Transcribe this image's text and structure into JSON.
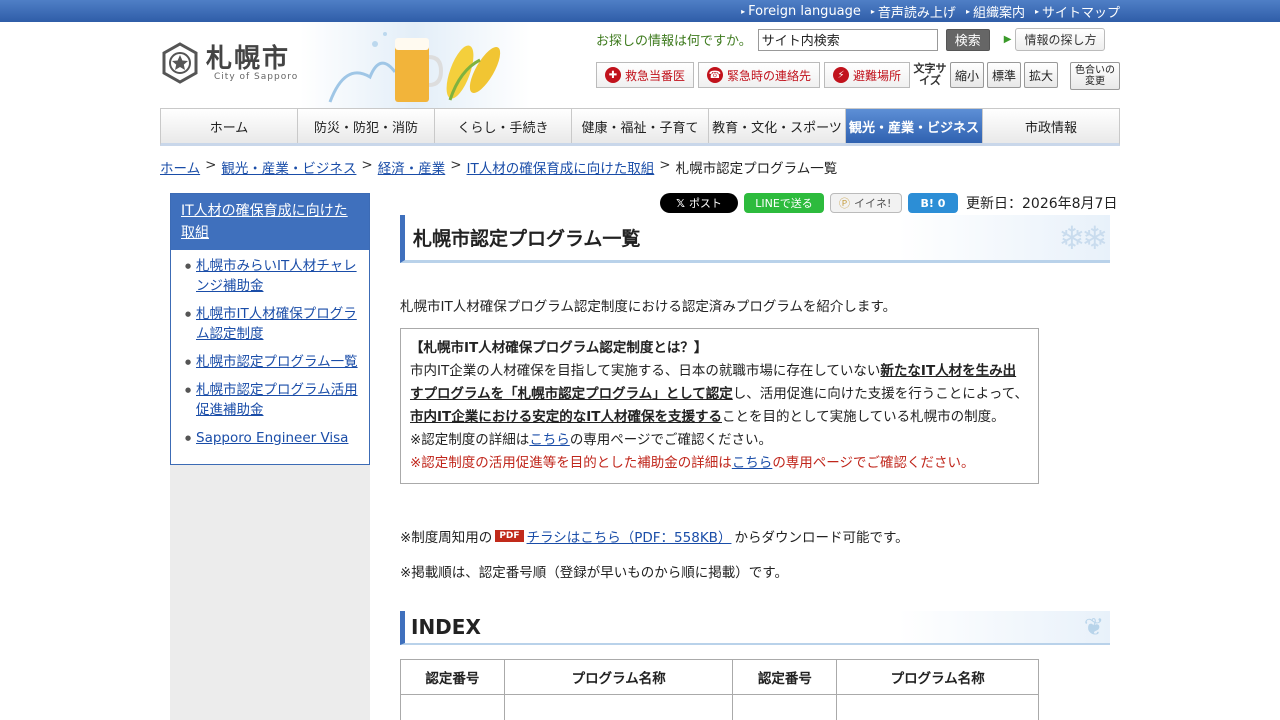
{
  "topbar": {
    "links": [
      "Foreign language",
      "音声読み上げ",
      "組織案内",
      "サイトマップ"
    ]
  },
  "header": {
    "logo_title": "札幌市",
    "logo_sub": "City of Sapporo",
    "search_prompt": "お探しの情報は何ですか。",
    "search_value": "サイト内検索",
    "search_button": "検索",
    "info_guide": "情報の探し方",
    "emergency": [
      "救急当番医",
      "緊急時の連絡先",
      "避難場所"
    ],
    "fontsize_label": "文字サイズ",
    "fontsize_buttons": [
      "縮小",
      "標準",
      "拡大"
    ],
    "color_change": "色合いの変更"
  },
  "nav": {
    "items": [
      "ホーム",
      "防災・防犯・消防",
      "くらし・手続き",
      "健康・福祉・子育て",
      "教育・文化・スポーツ",
      "観光・産業・ビジネス",
      "市政情報"
    ],
    "active_index": 5
  },
  "breadcrumb": {
    "links": [
      "ホーム",
      "観光・産業・ビジネス",
      "経済・産業",
      "IT人材の確保育成に向けた取組"
    ],
    "current": "札幌市認定プログラム一覧"
  },
  "sidebar": {
    "heading": "IT人材の確保育成に向けた取組",
    "items": [
      "札幌市みらいIT人材チャレンジ補助金",
      "札幌市IT人材確保プログラム認定制度",
      "札幌市認定プログラム一覧",
      "札幌市認定プログラム活用促進補助金",
      "Sapporo Engineer Visa"
    ]
  },
  "social": {
    "x": "ポスト",
    "line": "LINEで送る",
    "mixi": "イイネ!",
    "hatena": "B! 0",
    "updated": "更新日：2026年8月7日"
  },
  "main": {
    "title": "札幌市認定プログラム一覧",
    "intro": "札幌市IT人材確保プログラム認定制度における認定済みプログラムを紹介します。",
    "about_heading": "【札幌市IT人材確保プログラム認定制度とは？】",
    "about_p1": "市内IT企業の人材確保を目指して実施する、日本の就職市場に存在していない",
    "about_p1_bold": "新たなIT人材を生み出すプログラムを「札幌市認定プログラム」として認定",
    "about_p2": "し、活用促進に向けた支援を行うことによって、",
    "about_p2_bold": "市内IT企業における安定的なIT人材確保を支援する",
    "about_p3": "ことを目的として実施している札幌市の制度。",
    "about_note1_pre": "※認定制度の詳細は",
    "about_note1_link": "こちら",
    "about_note1_post": "の専用ページでご確認ください。",
    "about_note2_pre": "※認定制度の活用促進等を目的とした補助金の詳細は",
    "about_note2_link": "こちら",
    "about_note2_post": "の専用ページでご確認ください。",
    "flyer_pre": "※制度周知用の",
    "pdf_label": "PDF",
    "flyer_link": "チラシはこちら（PDF：558KB）",
    "flyer_post": "からダウンロード可能です。",
    "order_note": "※掲載順は、認定番号順（登録が早いものから順に掲載）です。",
    "index_title": "INDEX",
    "table_headers": [
      "認定番号",
      "プログラム名称",
      "認定番号",
      "プログラム名称"
    ]
  }
}
